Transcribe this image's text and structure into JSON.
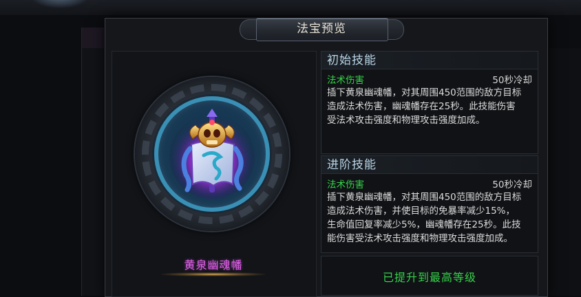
{
  "dialog": {
    "title": "法宝预览"
  },
  "item": {
    "name": "黄泉幽魂幡",
    "icon": "yellow-spring-soul-banner-icon",
    "name_color": "#e060e8"
  },
  "skills": {
    "initial": {
      "header": "初始技能",
      "type": "法术伤害",
      "cooldown": "50秒冷却",
      "desc_lines": [
        "插下黄泉幽魂幡，对其周围450范围的敌方目标",
        "造成法术伤害，幽魂幡存在25秒。此技能伤害",
        "受法术攻击强度和物理攻击强度加成。"
      ]
    },
    "advanced": {
      "header": "进阶技能",
      "type": "法术伤害",
      "cooldown": "50秒冷却",
      "desc_lines": [
        "插下黄泉幽魂幡，对其周围450范围的敌方目标",
        "造成法术伤害，并使目标的免暴率减少15%，",
        "生命值回复率减少5%，幽魂幡存在25秒。此技",
        "能伤害受法术攻击强度和物理攻击强度加成。"
      ]
    }
  },
  "status": {
    "max_level_text": "已提升到最高等级"
  },
  "colors": {
    "skill_type": "#36d24a",
    "header_text": "#b9d5e6",
    "max_level": "#36d24a"
  }
}
